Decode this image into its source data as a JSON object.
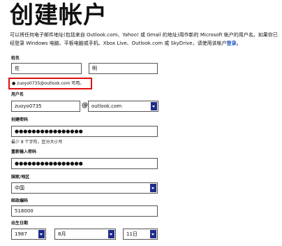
{
  "page": {
    "title": "创建帐户",
    "intro_part1": "可以将任何电子邮件地址(包括来自 Outlook.com、Yahoo! 或 Gmail 的地址)用作新的 Microsoft 帐户的用户名。如果你已经登录 Windows 电脑、平板电脑或手机、Xbox Live、Outlook.com 或 SkyDrive，请使用该帐户",
    "intro_link": "登录"
  },
  "form": {
    "name_label": "姓名",
    "last_name_value": "佐",
    "first_name_value": "明",
    "availability_message": "zuoyo0735@outlook.com 可用。",
    "username_label": "用户名",
    "username_value": "zuoyo0735",
    "at_sign": "@",
    "domain_value": "outlook.com",
    "password_label": "创建密码",
    "password_value": "●●●●●●●●●●●●●●●●",
    "password_hint": "最少 8 个字符，区分大小写",
    "confirm_label": "重新输入密码",
    "confirm_value": "●●●●●●●●●●●●●●●●",
    "region_label": "国家/地区",
    "region_value": "中国",
    "postal_label": "邮政编码",
    "postal_value": "518000",
    "birthday_label": "出生日期",
    "year_value": "1987",
    "month_value": "8月",
    "day_value": "11日"
  },
  "colors": {
    "link": "#1a54c4",
    "highlight_border": "#e01010",
    "dropdown_arrow": "#1f2c8a"
  }
}
